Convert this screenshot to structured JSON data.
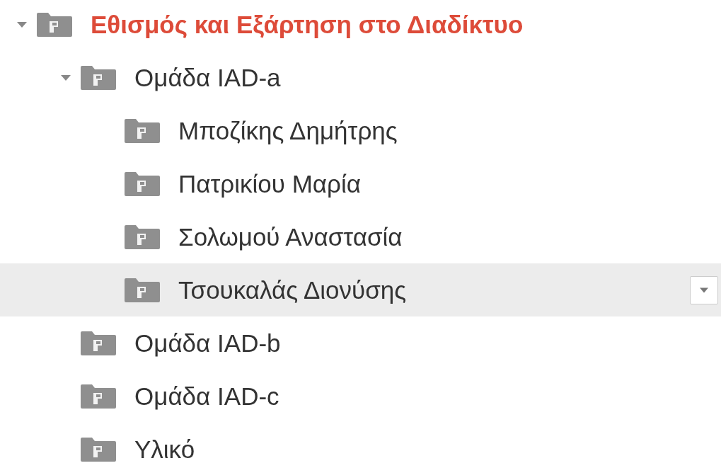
{
  "tree": [
    {
      "label": "Εθισμός και Εξάρτηση στο Διαδίκτυο",
      "selected": true,
      "hovered": false,
      "expanded": true,
      "children": [
        {
          "label": "Ομάδα IAD-a",
          "selected": false,
          "hovered": false,
          "expanded": true,
          "children": [
            {
              "label": "Μποζίκης Δημήτρης",
              "selected": false,
              "hovered": false
            },
            {
              "label": "Πατρικίου Μαρία",
              "selected": false,
              "hovered": false
            },
            {
              "label": "Σολωμού Αναστασία",
              "selected": false,
              "hovered": false
            },
            {
              "label": "Τσουκαλάς Διονύσης",
              "selected": false,
              "hovered": true
            }
          ]
        },
        {
          "label": "Ομάδα IAD-b",
          "selected": false,
          "hovered": false
        },
        {
          "label": "Ομάδα IAD-c",
          "selected": false,
          "hovered": false
        },
        {
          "label": "Υλικό",
          "selected": false,
          "hovered": false
        }
      ]
    }
  ]
}
